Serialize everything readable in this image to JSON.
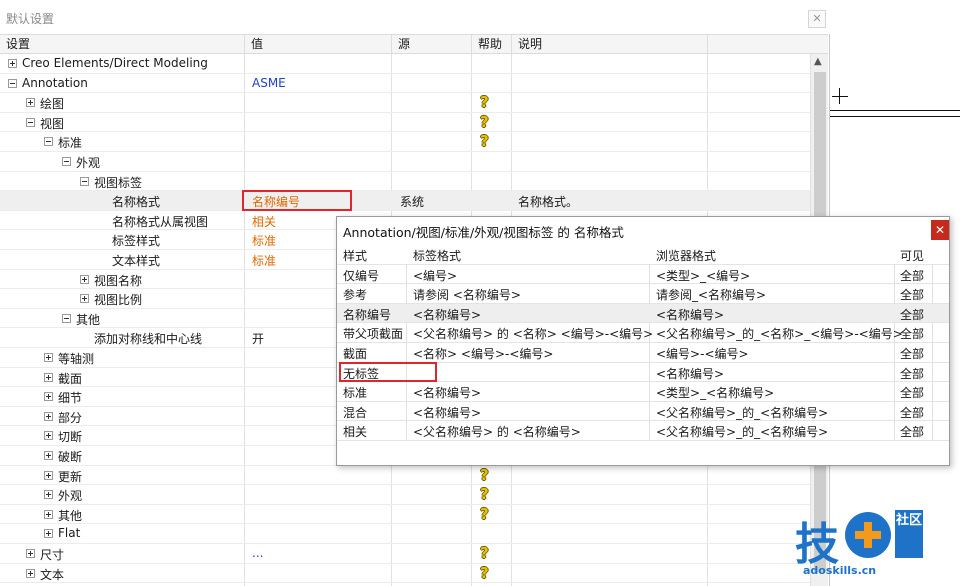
{
  "window": {
    "title": "默认设置",
    "close_icon": "close-icon"
  },
  "columns": [
    "设置",
    "值",
    "源",
    "帮助",
    "说明"
  ],
  "tree_rows": [
    {
      "label": "Creo Elements/Direct Modeling",
      "indent": 0,
      "expander": "plus",
      "value": "",
      "source": "",
      "help": false,
      "desc": ""
    },
    {
      "label": "Annotation",
      "indent": 0,
      "expander": "minus",
      "value": "ASME",
      "value_color": "blue",
      "source": "",
      "help": false,
      "desc": ""
    },
    {
      "label": "绘图",
      "indent": 1,
      "expander": "plus",
      "value": "",
      "source": "",
      "help": true,
      "desc": ""
    },
    {
      "label": "视图",
      "indent": 1,
      "expander": "minus",
      "value": "",
      "source": "",
      "help": true,
      "desc": ""
    },
    {
      "label": "标准",
      "indent": 2,
      "expander": "minus",
      "value": "",
      "source": "",
      "help": true,
      "desc": ""
    },
    {
      "label": "外观",
      "indent": 3,
      "expander": "minus",
      "value": "",
      "source": "",
      "help": false,
      "desc": ""
    },
    {
      "label": "视图标签",
      "indent": 4,
      "expander": "minus",
      "value": "",
      "source": "",
      "help": false,
      "desc": ""
    },
    {
      "label": "名称格式",
      "indent": 5,
      "expander": "none",
      "value": "名称编号",
      "value_color": "orange",
      "source": "系统",
      "help": false,
      "desc": "名称格式。",
      "selected": true
    },
    {
      "label": "名称格式从属视图",
      "indent": 5,
      "expander": "none",
      "value": "相关",
      "value_color": "orange",
      "source": "",
      "help": false,
      "desc": ""
    },
    {
      "label": "标签样式",
      "indent": 5,
      "expander": "none",
      "value": "标准",
      "value_color": "orange",
      "source": "",
      "help": false,
      "desc": ""
    },
    {
      "label": "文本样式",
      "indent": 5,
      "expander": "none",
      "value": "标准",
      "value_color": "orange",
      "source": "",
      "help": false,
      "desc": ""
    },
    {
      "label": "视图名称",
      "indent": 4,
      "expander": "plus",
      "value": "",
      "source": "",
      "help": false,
      "desc": ""
    },
    {
      "label": "视图比例",
      "indent": 4,
      "expander": "plus",
      "value": "",
      "source": "",
      "help": false,
      "desc": ""
    },
    {
      "label": "其他",
      "indent": 3,
      "expander": "minus",
      "value": "",
      "source": "",
      "help": false,
      "desc": ""
    },
    {
      "label": "添加对称线和中心线",
      "indent": 4,
      "expander": "none",
      "value": "开",
      "value_color": "black",
      "source": "",
      "help": false,
      "desc": ""
    },
    {
      "label": "等轴测",
      "indent": 2,
      "expander": "plus",
      "value": "",
      "source": "",
      "help": false,
      "desc": ""
    },
    {
      "label": "截面",
      "indent": 2,
      "expander": "plus",
      "value": "",
      "source": "",
      "help": false,
      "desc": ""
    },
    {
      "label": "细节",
      "indent": 2,
      "expander": "plus",
      "value": "",
      "source": "",
      "help": false,
      "desc": ""
    },
    {
      "label": "部分",
      "indent": 2,
      "expander": "plus",
      "value": "",
      "source": "",
      "help": false,
      "desc": ""
    },
    {
      "label": "切断",
      "indent": 2,
      "expander": "plus",
      "value": "",
      "source": "",
      "help": false,
      "desc": ""
    },
    {
      "label": "破断",
      "indent": 2,
      "expander": "plus",
      "value": "",
      "source": "",
      "help": false,
      "desc": ""
    },
    {
      "label": "更新",
      "indent": 2,
      "expander": "plus",
      "value": "",
      "source": "",
      "help": true,
      "desc": ""
    },
    {
      "label": "外观",
      "indent": 2,
      "expander": "plus",
      "value": "",
      "source": "",
      "help": true,
      "desc": ""
    },
    {
      "label": "其他",
      "indent": 2,
      "expander": "plus",
      "value": "",
      "source": "",
      "help": true,
      "desc": ""
    },
    {
      "label": "Flat",
      "indent": 2,
      "expander": "plus",
      "value": "",
      "source": "",
      "help": false,
      "desc": ""
    },
    {
      "label": "尺寸",
      "indent": 1,
      "expander": "plus",
      "value": "...",
      "value_color": "blue",
      "source": "",
      "help": true,
      "desc": ""
    },
    {
      "label": "文本",
      "indent": 1,
      "expander": "plus",
      "value": "",
      "source": "",
      "help": true,
      "desc": ""
    }
  ],
  "popup": {
    "title": "Annotation/视图/标准/外观/视图标签 的 名称格式",
    "headers": [
      "样式",
      "标签格式",
      "浏览器格式",
      "可见"
    ],
    "rows": [
      {
        "style": "仅编号",
        "label": "<编号>",
        "browser": "<类型>_<编号>",
        "visible": "全部"
      },
      {
        "style": "参考",
        "label": "请参阅 <名称编号>",
        "browser": "请参阅_<名称编号>",
        "visible": "全部"
      },
      {
        "style": "名称编号",
        "label": "<名称编号>",
        "browser": "<名称编号>",
        "visible": "全部",
        "selected": true
      },
      {
        "style": "带父项截面",
        "label": "<父名称编号> 的 <名称> <编号>-<编号>",
        "browser": "<父名称编号>_的_<名称>_<编号>-<编号>",
        "visible": "全部"
      },
      {
        "style": "截面",
        "label": "<名称> <编号>-<编号>",
        "browser": "<编号>-<编号>",
        "visible": "全部"
      },
      {
        "style": "无标签",
        "label": "",
        "browser": "<名称编号>",
        "visible": "全部"
      },
      {
        "style": "标准",
        "label": "<名称编号>",
        "browser": "<类型>_<名称编号>",
        "visible": "全部"
      },
      {
        "style": "混合",
        "label": "<名称编号>",
        "browser": "<父名称编号>_的_<名称编号>",
        "visible": "全部"
      },
      {
        "style": "相关",
        "label": "<父名称编号> 的 <名称编号>",
        "browser": "<父名称编号>_的_<名称编号>",
        "visible": "全部"
      }
    ]
  },
  "watermark": {
    "char_main": "技",
    "char_side": "社区",
    "url": "adoskills.cn"
  },
  "colors": {
    "value_blue": "#1f3fd1",
    "value_orange": "#e06a00",
    "highlight_red": "#e0262d",
    "help_yellow": "#e6c200",
    "brand_blue": "#1e73c8",
    "brand_orange": "#f39a1b"
  }
}
